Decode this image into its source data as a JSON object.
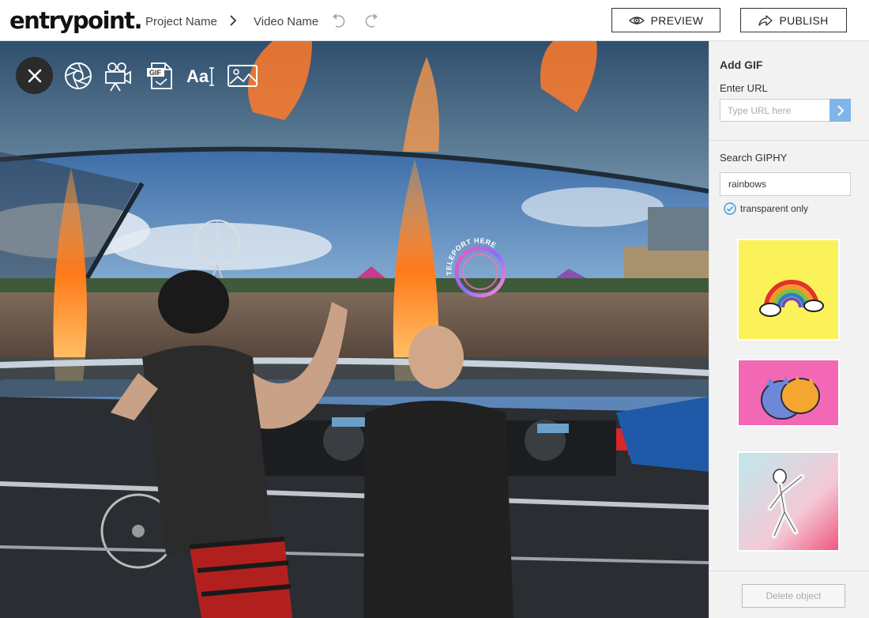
{
  "app": {
    "logo": "entrypoint.",
    "breadcrumb": [
      "Project Name",
      "Video Name"
    ]
  },
  "header": {
    "preview_label": "PREVIEW",
    "publish_label": "PUBLISH"
  },
  "scene": {
    "teleport_label": "TELEPORT HERE"
  },
  "toolbar": {
    "tools": [
      "close-icon",
      "aperture-icon",
      "video-camera-icon",
      "gif-file-icon",
      "text-icon",
      "image-icon"
    ],
    "gif_tool_text": "GIF",
    "text_tool_text": "Aa"
  },
  "panel": {
    "title": "Add GIF",
    "url_label": "Enter URL",
    "url_placeholder": "Type URL here",
    "search_label": "Search GIPHY",
    "search_value": "rainbows",
    "transparent_label": "transparent only",
    "transparent_checked": true,
    "results": [
      "rainbow-cloud-gif",
      "hugging-cats-gif",
      "dancing-character-gif"
    ],
    "delete_label": "Delete object"
  },
  "colors": {
    "accent": "#7fb5e8",
    "check": "#3a9bd9"
  }
}
